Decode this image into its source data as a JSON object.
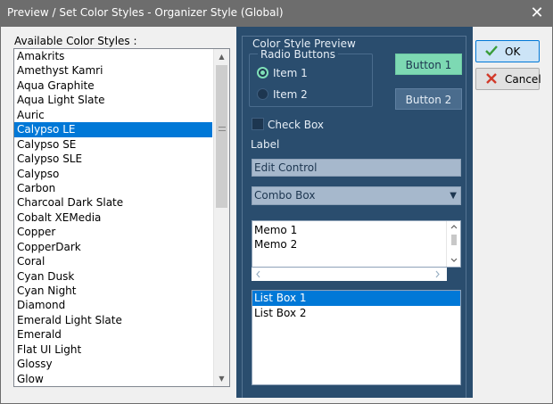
{
  "window": {
    "title": "Preview / Set Color Styles - Organizer Style (Global)",
    "close_glyph": "✕"
  },
  "styles_list": {
    "label": "Available Color Styles :",
    "selected": "Calypso LE",
    "items": [
      "Amakrits",
      "Amethyst Kamri",
      "Aqua Graphite",
      "Aqua Light Slate",
      "Auric",
      "Calypso LE",
      "Calypso SE",
      "Calypso SLE",
      "Calypso",
      "Carbon",
      "Charcoal Dark Slate",
      "Cobalt XEMedia",
      "Copper",
      "CopperDark",
      "Coral",
      "Cyan Dusk",
      "Cyan Night",
      "Diamond",
      "Emerald Light Slate",
      "Emerald",
      "Flat UI Light",
      "Glossy",
      "Glow"
    ]
  },
  "preview": {
    "title": "Color Style Preview",
    "radio_group_label": "Radio Buttons",
    "radio_items": [
      "Item 1",
      "Item 2"
    ],
    "radio_checked": "Item 1",
    "button1_label": "Button 1",
    "button2_label": "Button 2",
    "checkbox_label": "Check Box",
    "label_text": "Label",
    "edit_value": "Edit Control",
    "combo_value": "Combo Box",
    "memo_lines": [
      "Memo 1",
      "Memo 2"
    ],
    "listbox_items": [
      "List Box 1",
      "List Box 2"
    ],
    "listbox_selected": "List Box 1"
  },
  "buttons": {
    "ok_label": "OK",
    "cancel_label": "Cancel"
  },
  "colors": {
    "titlebar": "#6d6d6d",
    "preview_bg": "#2a4d6e",
    "accent_green": "#7dd9b3",
    "selection_blue": "#0078d7"
  },
  "icons": {
    "ok": "check-icon",
    "cancel": "x-icon"
  }
}
